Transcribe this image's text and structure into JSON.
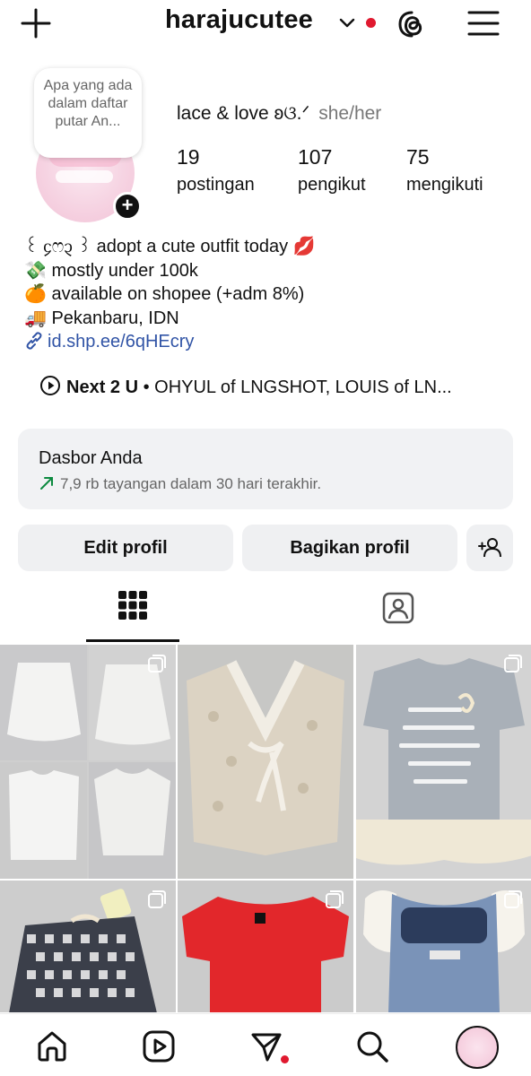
{
  "header": {
    "username": "harajucutee",
    "icons": [
      "plus-icon",
      "chevron-down-icon",
      "threads-icon",
      "menu-icon"
    ],
    "notification_dot_color": "#e0192f"
  },
  "profile": {
    "note_text": "Apa yang ada dalam daftar putar An...",
    "display_name": "lace & love ʚଓ.ᐟ",
    "pronouns": "she/her",
    "stats": [
      {
        "value": "19",
        "label": "postingan"
      },
      {
        "value": "107",
        "label": "pengikut"
      },
      {
        "value": "75",
        "label": "mengikuti"
      }
    ]
  },
  "bio": {
    "lines": [
      "꒰ ᧔ෆ᧓ ꒱ adopt a cute outfit today 💋",
      "💸 mostly under 100k",
      "🍊 available on shopee (+adm 8%)",
      "🚚 Pekanbaru, IDN"
    ],
    "link": "id.shp.ee/6qHEcry",
    "link_color": "#3154a6"
  },
  "music": {
    "title": "Next 2 U",
    "artists": "• OHYUL of LNGSHOT, LOUIS of LN..."
  },
  "dashboard": {
    "title": "Dasbor Anda",
    "subtitle": "7,9 rb tayangan dalam 30 hari terakhir."
  },
  "buttons": {
    "edit": "Edit profil",
    "share": "Bagikan profil"
  },
  "tabs": [
    "grid-icon",
    "tagged-icon"
  ],
  "posts": [
    {
      "desc": "four white blouses and skirts collage",
      "multi": true
    },
    {
      "desc": "cream lace crochet bolero",
      "multi": false
    },
    {
      "desc": "grey tee with lace hem",
      "multi": true
    },
    {
      "desc": "gingham skirt",
      "multi": true
    },
    {
      "desc": "red top",
      "multi": true
    },
    {
      "desc": "blue denim pinafore",
      "multi": true
    }
  ],
  "bottom_nav": [
    "home-icon",
    "reels-icon",
    "direct-icon",
    "search-icon",
    "profile-avatar"
  ]
}
